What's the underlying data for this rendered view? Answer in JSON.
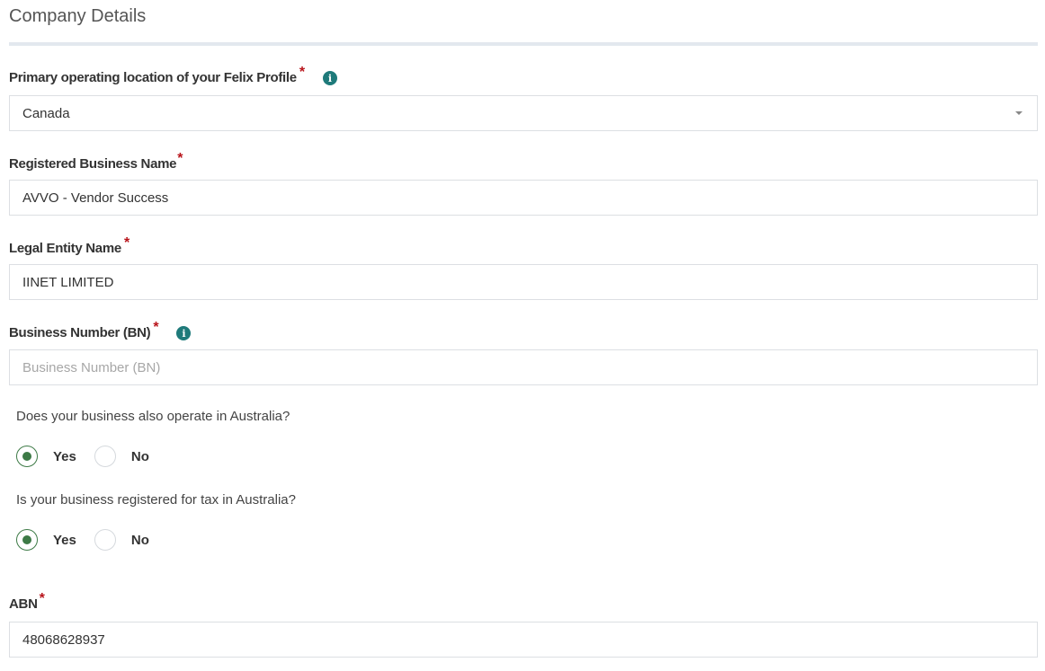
{
  "section": {
    "title": "Company Details"
  },
  "fields": {
    "location": {
      "label": "Primary operating location of your Felix Profile",
      "value": "Canada"
    },
    "business_name": {
      "label": "Registered Business Name",
      "value": "AVVO - Vendor Success"
    },
    "legal_entity": {
      "label": "Legal Entity Name",
      "value": "IINET LIMITED"
    },
    "business_number": {
      "label": "Business Number (BN)",
      "value": "",
      "placeholder": "Business Number (BN)"
    },
    "abn": {
      "label": "ABN",
      "value": "48068628937"
    }
  },
  "questions": {
    "operate_australia": {
      "text": "Does your business also operate in Australia?",
      "yes": "Yes",
      "no": "No",
      "selected": "Yes"
    },
    "tax_australia": {
      "text": "Is your business registered for tax in Australia?",
      "yes": "Yes",
      "no": "No",
      "selected": "Yes"
    }
  },
  "required_mark": "*",
  "info_glyph": "i",
  "colors": {
    "required": "#b8131a",
    "info": "#1e7a7a",
    "radio_checked": "#3d7a46"
  }
}
